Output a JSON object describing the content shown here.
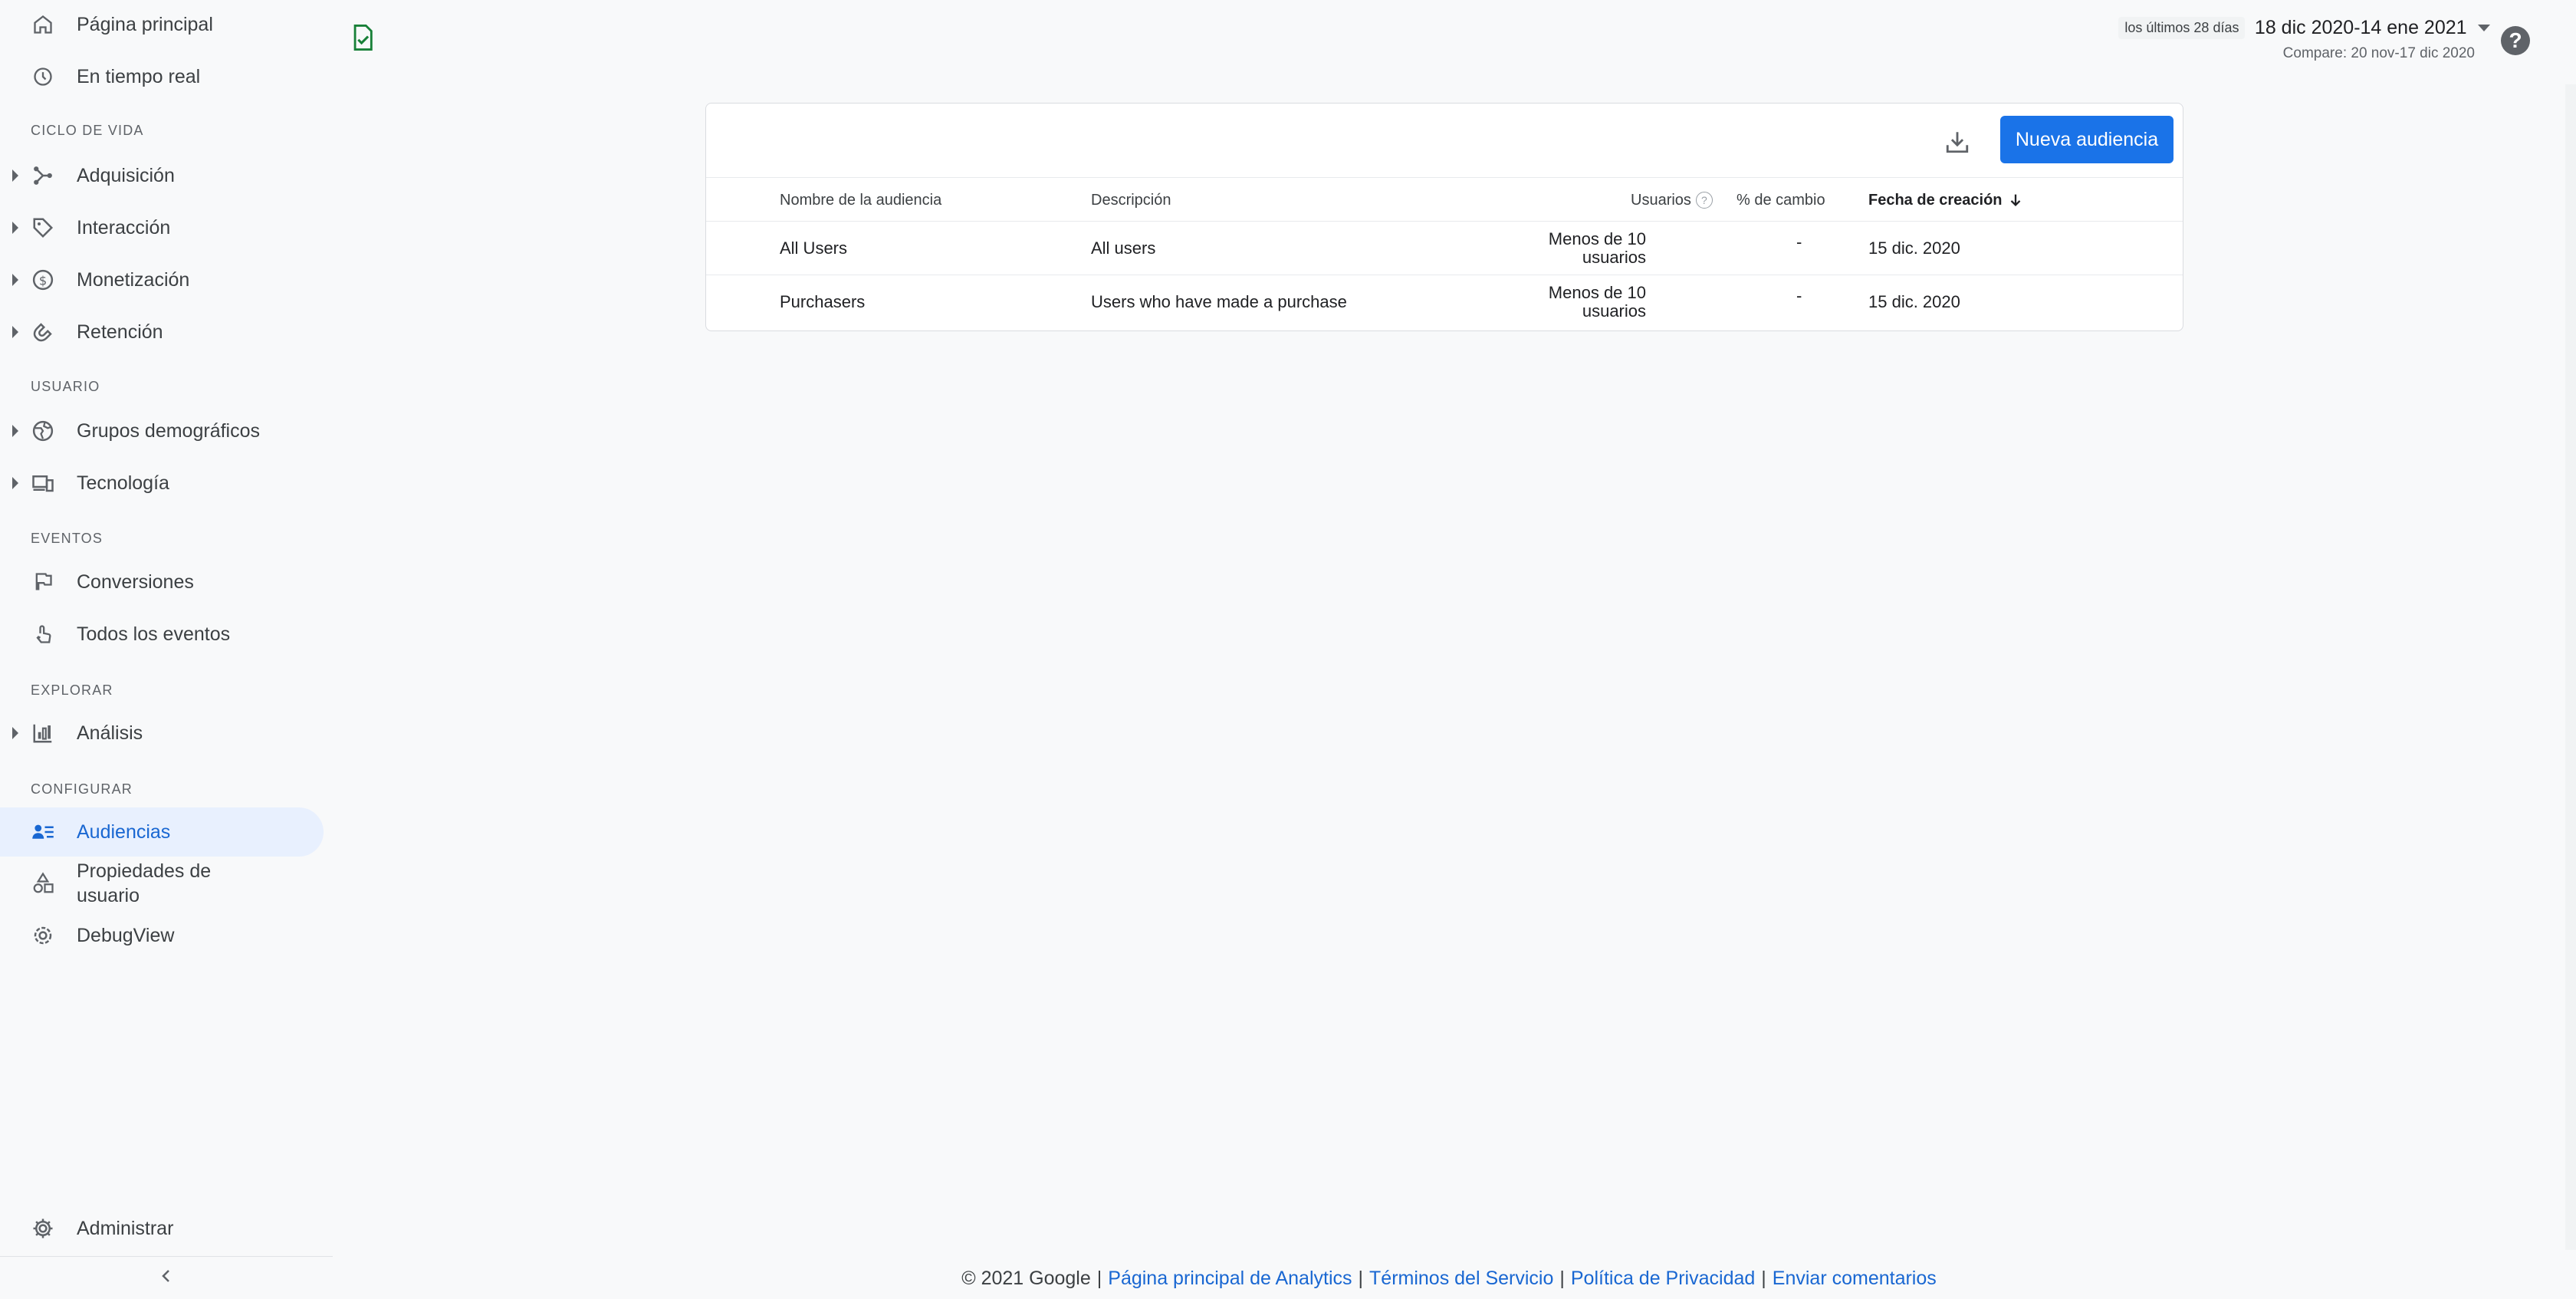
{
  "sidebar": {
    "top_items": [
      {
        "label": "Página principal",
        "icon": "home-icon"
      },
      {
        "label": "En tiempo real",
        "icon": "clock-icon"
      }
    ],
    "sections": {
      "lifecycle": "CICLO DE VIDA",
      "user": "USUARIO",
      "events": "EVENTOS",
      "explore": "EXPLORAR",
      "configure": "CONFIGURAR"
    },
    "lifecycle_items": [
      {
        "label": "Adquisición",
        "icon": "acquisition-icon"
      },
      {
        "label": "Interacción",
        "icon": "tag-icon"
      },
      {
        "label": "Monetización",
        "icon": "dollar-icon"
      },
      {
        "label": "Retención",
        "icon": "magnet-icon"
      }
    ],
    "user_items": [
      {
        "label": "Grupos demográficos",
        "icon": "globe-icon"
      },
      {
        "label": "Tecnología",
        "icon": "devices-icon"
      }
    ],
    "event_items": [
      {
        "label": "Conversiones",
        "icon": "flag-icon"
      },
      {
        "label": "Todos los eventos",
        "icon": "touch-icon"
      }
    ],
    "explore_items": [
      {
        "label": "Análisis",
        "icon": "analysis-icon"
      }
    ],
    "configure_items": [
      {
        "label": "Audiencias",
        "icon": "audience-icon",
        "active": true
      },
      {
        "label": "Propiedades de usuario",
        "icon": "shapes-icon"
      },
      {
        "label": "DebugView",
        "icon": "bug-icon"
      }
    ],
    "admin": {
      "label": "Administrar",
      "icon": "gear-icon"
    }
  },
  "header": {
    "date_chip": "los últimos 28 días",
    "date_range": "18 dic 2020-14 ene 2021",
    "compare": "Compare: 20 nov-17 dic 2020"
  },
  "card": {
    "new_button": "Nueva audiencia",
    "columns": {
      "name": "Nombre de la audiencia",
      "description": "Descripción",
      "users": "Usuarios",
      "change": "% de cambio",
      "created": "Fecha de creación"
    },
    "rows": [
      {
        "name": "All Users",
        "description": "All users",
        "users_line1": "Menos de 10",
        "users_line2": "usuarios",
        "change": "-",
        "created": "15 dic. 2020"
      },
      {
        "name": "Purchasers",
        "description": "Users who have made a purchase",
        "users_line1": "Menos de 10",
        "users_line2": "usuarios",
        "change": "-",
        "created": "15 dic. 2020"
      }
    ]
  },
  "footer": {
    "copyright": "© 2021 Google",
    "links": [
      "Página principal de Analytics",
      "Términos del Servicio",
      "Política de Privacidad",
      "Enviar comentarios"
    ]
  },
  "colors": {
    "accent": "#1a73e8",
    "active_bg": "#e8f0fe",
    "doc_icon": "#188038"
  }
}
